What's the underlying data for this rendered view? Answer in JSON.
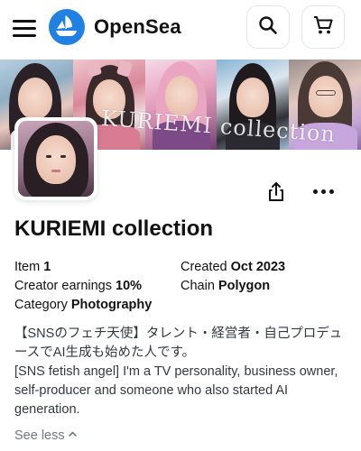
{
  "header": {
    "brand": "OpenSea",
    "icons": [
      "menu-icon",
      "opensea-logo-icon",
      "search-icon",
      "cart-icon"
    ]
  },
  "banner": {
    "caption": "KURIEMI collection"
  },
  "actions": {
    "icons": [
      "share-icon",
      "more-icon"
    ]
  },
  "collection": {
    "title": "KURIEMI collection",
    "stats": {
      "items_label": "Item",
      "items_value": "1",
      "created_label": "Created",
      "created_value": "Oct 2023",
      "earnings_label": "Creator earnings",
      "earnings_value": "10%",
      "chain_label": "Chain",
      "chain_value": "Polygon",
      "category_label": "Category",
      "category_value": "Photography"
    },
    "description_jp": "【SNSのフェチ天使】タレント・経営者・自己プロデュースでAI生成も始めた人です。",
    "description_en": "[SNS fetish angel] I'm a TV personality, business owner, self-producer and someone who also started AI generation.",
    "see_less": "See less"
  },
  "colors": {
    "brand_blue": "#2081e2",
    "text_primary": "#121212",
    "text_secondary": "#707a83"
  }
}
